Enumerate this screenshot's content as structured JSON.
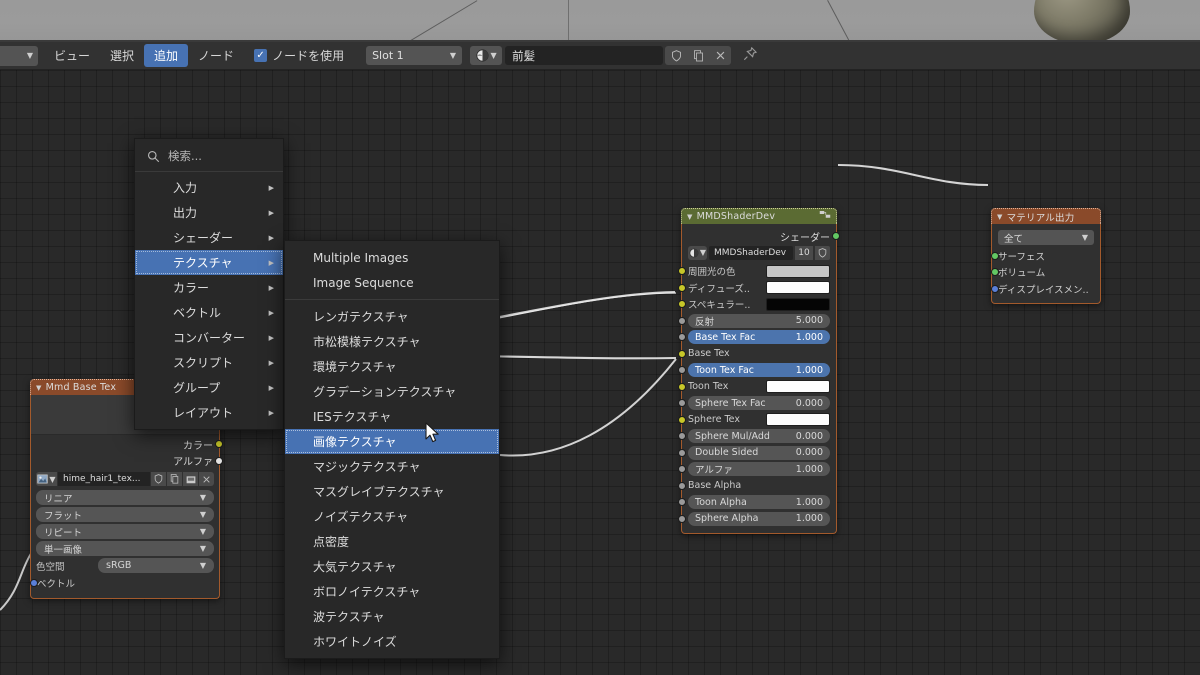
{
  "app": {
    "editor": "shader-editor"
  },
  "toolbar": {
    "editor_type_icon": "editor-type-icon",
    "menus": [
      {
        "label": "ビュー",
        "active": false
      },
      {
        "label": "選択",
        "active": false
      },
      {
        "label": "追加",
        "active": true
      },
      {
        "label": "ノード",
        "active": false
      }
    ],
    "use_nodes_checked": true,
    "use_nodes_label": "ノードを使用",
    "slot": {
      "value": "Slot 1"
    },
    "material_name": "前髪",
    "buttons": {
      "shield": "fake-user-icon",
      "copy": "new-material-icon",
      "close": "unlink-icon",
      "pin": "pin-icon"
    }
  },
  "add_menu": {
    "search_placeholder": "検索...",
    "items": [
      {
        "label": "入力",
        "submenu": true,
        "selected": false
      },
      {
        "label": "出力",
        "submenu": true,
        "selected": false
      },
      {
        "label": "シェーダー",
        "submenu": true,
        "selected": false
      },
      {
        "label": "テクスチャ",
        "submenu": true,
        "selected": true
      },
      {
        "label": "カラー",
        "submenu": true,
        "selected": false
      },
      {
        "label": "ベクトル",
        "submenu": true,
        "selected": false
      },
      {
        "label": "コンバーター",
        "submenu": true,
        "selected": false
      },
      {
        "label": "スクリプト",
        "submenu": true,
        "selected": false
      },
      {
        "label": "グループ",
        "submenu": true,
        "selected": false
      },
      {
        "label": "レイアウト",
        "submenu": true,
        "selected": false
      }
    ]
  },
  "texture_submenu": {
    "top_items": [
      {
        "label": "Multiple Images",
        "selected": false
      },
      {
        "label": "Image Sequence",
        "selected": false
      }
    ],
    "items": [
      {
        "label": "レンガテクスチャ",
        "selected": false
      },
      {
        "label": "市松模様テクスチャ",
        "selected": false
      },
      {
        "label": "環境テクスチャ",
        "selected": false
      },
      {
        "label": "グラデーションテクスチャ",
        "selected": false
      },
      {
        "label": "IESテクスチャ",
        "selected": false
      },
      {
        "label": "画像テクスチャ",
        "selected": true
      },
      {
        "label": "マジックテクスチャ",
        "selected": false
      },
      {
        "label": "マスグレイブテクスチャ",
        "selected": false
      },
      {
        "label": "ノイズテクスチャ",
        "selected": false
      },
      {
        "label": "点密度",
        "selected": false
      },
      {
        "label": "大気テクスチャ",
        "selected": false
      },
      {
        "label": "ボロノイテクスチャ",
        "selected": false
      },
      {
        "label": "波テクスチャ",
        "selected": false
      },
      {
        "label": "ホワイトノイズ",
        "selected": false
      }
    ]
  },
  "nodes": {
    "image_texture": {
      "title": "Mmd Base Tex",
      "outputs": [
        {
          "label": "カラー",
          "socket": "yellow"
        },
        {
          "label": "アルファ",
          "socket": "white"
        }
      ],
      "image_name": "hime_hair1_tex...",
      "image_buttons": [
        "fake-user-icon",
        "new-image-icon",
        "open-image-icon",
        "unlink-icon"
      ],
      "selects": [
        {
          "value": "リニア"
        },
        {
          "value": "フラット"
        },
        {
          "value": "リピート"
        },
        {
          "value": "単一画像"
        }
      ],
      "color_space": {
        "label": "色空間",
        "value": "sRGB"
      },
      "input": {
        "label": "ベクトル",
        "socket": "blue"
      }
    },
    "mmd_shader": {
      "title": "MMDShaderDev",
      "output": {
        "label": "シェーダー",
        "socket": "green"
      },
      "id_block": {
        "name": "MMDShaderDev",
        "users": "10",
        "shield": "fake-user-icon"
      },
      "rows": [
        {
          "label": "周囲光の色",
          "type": "color",
          "color": "#c6c6c6",
          "socket": "yellow"
        },
        {
          "label": "ディフューズ..",
          "type": "color",
          "color": "#fdfdfd",
          "socket": "yellow"
        },
        {
          "label": "スペキュラー..",
          "type": "color",
          "color": "#050505",
          "socket": "yellow"
        },
        {
          "label": "反射",
          "type": "value",
          "value": "5.000",
          "socket": "gray",
          "highlight": false
        },
        {
          "label": "Base Tex Fac",
          "type": "value",
          "value": "1.000",
          "socket": "gray",
          "highlight": true
        },
        {
          "label": "Base Tex",
          "type": "socket-only",
          "value": "",
          "socket": "yellow",
          "highlight": false
        },
        {
          "label": "Toon Tex Fac",
          "type": "value",
          "value": "1.000",
          "socket": "gray",
          "highlight": true
        },
        {
          "label": "Toon Tex",
          "type": "color",
          "color": "#fdfdfd",
          "socket": "yellow"
        },
        {
          "label": "Sphere Tex Fac",
          "type": "value",
          "value": "0.000",
          "socket": "gray",
          "highlight": false
        },
        {
          "label": "Sphere Tex",
          "type": "color",
          "color": "#fdfdfd",
          "socket": "yellow"
        },
        {
          "label": "Sphere Mul/Add",
          "type": "value",
          "value": "0.000",
          "socket": "gray",
          "highlight": false
        },
        {
          "label": "Double Sided",
          "type": "value",
          "value": "0.000",
          "socket": "gray",
          "highlight": false
        },
        {
          "label": "アルファ",
          "type": "value",
          "value": "1.000",
          "socket": "gray",
          "highlight": false
        },
        {
          "label": "Base Alpha",
          "type": "socket-only",
          "value": "",
          "socket": "gray",
          "highlight": false
        },
        {
          "label": "Toon Alpha",
          "type": "value",
          "value": "1.000",
          "socket": "gray",
          "highlight": false
        },
        {
          "label": "Sphere Alpha",
          "type": "value",
          "value": "1.000",
          "socket": "gray",
          "highlight": false
        }
      ]
    },
    "material_output": {
      "title": "マテリアル出力",
      "target": "全て",
      "inputs": [
        {
          "label": "サーフェス",
          "socket": "green"
        },
        {
          "label": "ボリューム",
          "socket": "green"
        },
        {
          "label": "ディスプレイスメン..",
          "socket": "blue"
        }
      ]
    }
  }
}
